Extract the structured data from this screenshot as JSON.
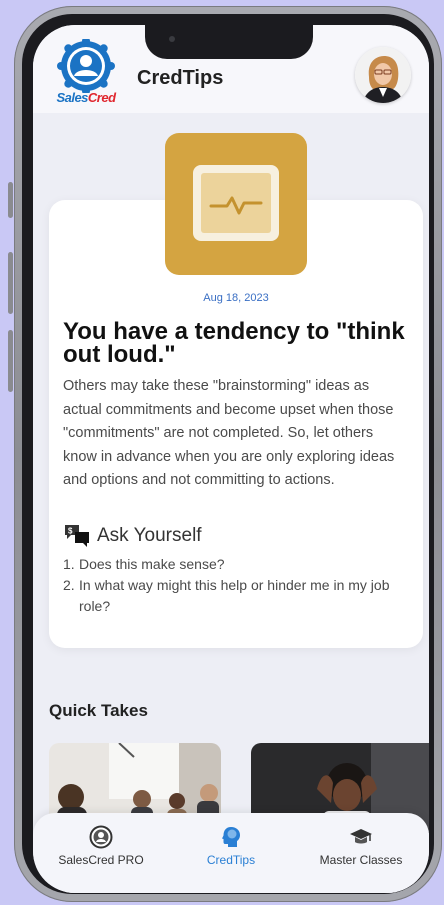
{
  "header": {
    "logo_text_1": "Sales",
    "logo_text_2": "Cred",
    "title": "CredTips"
  },
  "tip": {
    "date": "Aug 18, 2023",
    "title": "You have a tendency to \"think out loud.\"",
    "body": "Others may take these \"brainstorming\" ideas as actual commitments and become upset when those \"commitments\" are not completed. So, let others know in advance when you are only exploring ideas and options and not committing to actions.",
    "ask_label": "Ask Yourself",
    "questions": [
      {
        "num": "1.",
        "text": "Does this make sense?"
      },
      {
        "num": "2.",
        "text": "In what way might this help or hinder me in my job role?"
      }
    ]
  },
  "quick_takes": {
    "title": "Quick Takes"
  },
  "nav": {
    "items": [
      {
        "label": "SalesCred PRO",
        "icon": "user-circle-icon"
      },
      {
        "label": "CredTips",
        "icon": "brain-head-icon"
      },
      {
        "label": "Master Classes",
        "icon": "graduation-cap-icon"
      }
    ],
    "active_color": "#2a7fd4"
  },
  "colors": {
    "background": "#c9c8f5",
    "tip_icon": "#d4a441",
    "brand_blue": "#1b73c4"
  }
}
